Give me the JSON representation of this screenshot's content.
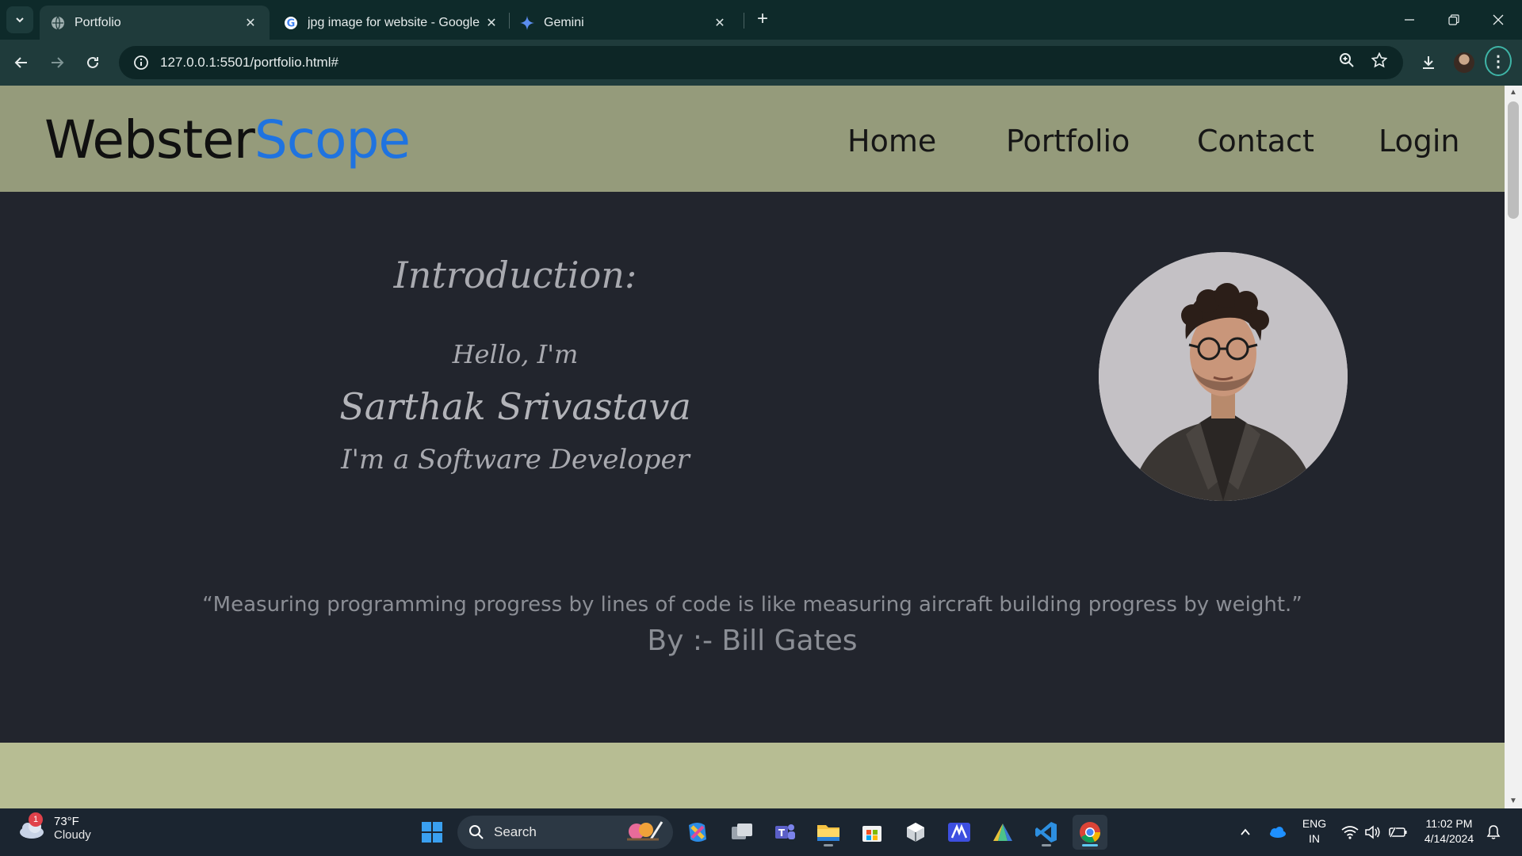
{
  "browser": {
    "tabs": [
      {
        "title": "Portfolio",
        "active": true
      },
      {
        "title": "jpg image for website - Google",
        "active": false
      },
      {
        "title": "Gemini",
        "active": false
      }
    ],
    "url": "127.0.0.1:5501/portfolio.html#"
  },
  "site": {
    "logo_main": "Webster",
    "logo_accent": "Scope",
    "nav": [
      "Home",
      "Portfolio",
      "Contact",
      "Login"
    ],
    "intro_title": "Introduction:",
    "hello": "Hello, I'm",
    "name": "Sarthak Srivastava",
    "role": "I'm a Software Developer",
    "quote": "“Measuring programming progress by lines of code is like measuring aircraft building progress by weight.”",
    "author": "By :- Bill Gates"
  },
  "taskbar": {
    "weather_temp": "73°F",
    "weather_desc": "Cloudy",
    "weather_badge": "1",
    "search_label": "Search",
    "lang_1": "ENG",
    "lang_2": "IN",
    "time": "11:02 PM",
    "date": "4/14/2024"
  },
  "colors": {
    "header_bg": "#959b7b",
    "hero_bg": "#22252d",
    "logo_accent": "#1f73e0",
    "footer_band": "#b7bd93"
  }
}
